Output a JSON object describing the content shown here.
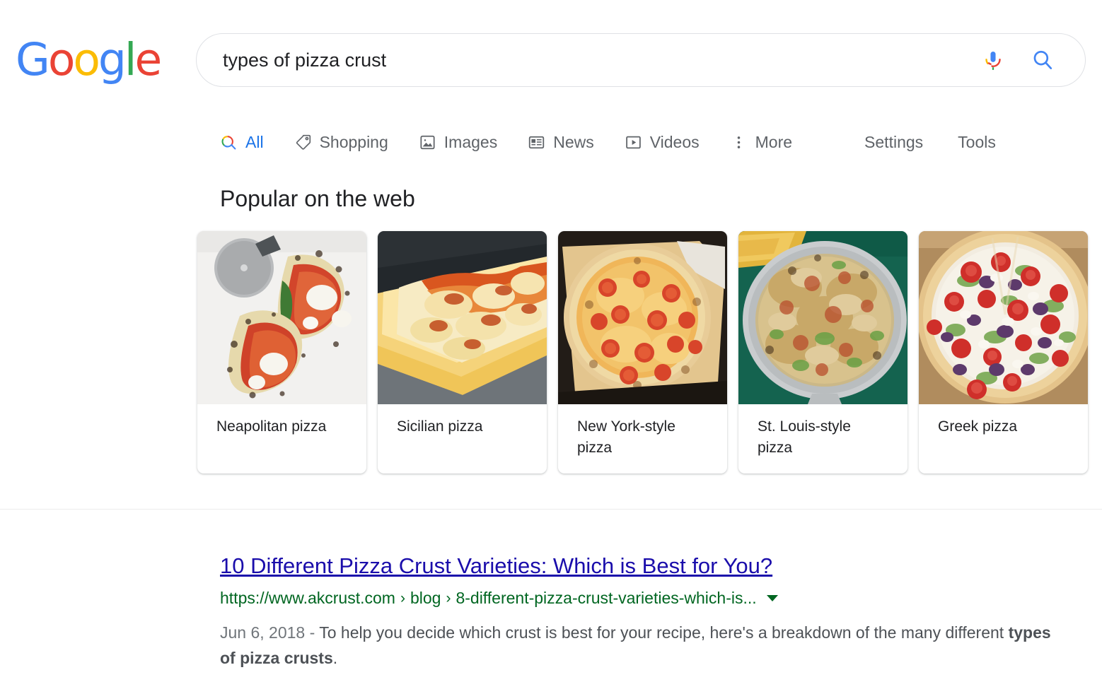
{
  "brand": {
    "logo_text": "Google",
    "logo_letters": [
      {
        "char": "G",
        "color": "#4285F4"
      },
      {
        "char": "o",
        "color": "#EA4335"
      },
      {
        "char": "o",
        "color": "#FBBC05"
      },
      {
        "char": "g",
        "color": "#4285F4"
      },
      {
        "char": "l",
        "color": "#34A853"
      },
      {
        "char": "e",
        "color": "#EA4335"
      }
    ]
  },
  "search": {
    "query": "types of pizza crust",
    "placeholder": "Search",
    "mic_icon": "microphone-icon",
    "search_icon": "search-icon"
  },
  "tabs": [
    {
      "label": "All",
      "icon": "search-icon",
      "active": true
    },
    {
      "label": "Shopping",
      "icon": "price-tag-icon",
      "active": false
    },
    {
      "label": "Images",
      "icon": "image-icon",
      "active": false
    },
    {
      "label": "News",
      "icon": "news-article-icon",
      "active": false
    },
    {
      "label": "Videos",
      "icon": "video-play-icon",
      "active": false
    },
    {
      "label": "More",
      "icon": "more-vertical-icon",
      "active": false
    }
  ],
  "tools": [
    {
      "label": "Settings"
    },
    {
      "label": "Tools"
    }
  ],
  "popular": {
    "heading": "Popular on the web",
    "cards": [
      {
        "label": "Neapolitan pizza",
        "image_alt": "neapolitan-pizza-photo"
      },
      {
        "label": "Sicilian pizza",
        "image_alt": "sicilian-pizza-photo"
      },
      {
        "label": "New York-style pizza",
        "image_alt": "new-york-style-pizza-photo"
      },
      {
        "label": "St. Louis-style pizza",
        "image_alt": "st-louis-style-pizza-photo"
      },
      {
        "label": "Greek pizza",
        "image_alt": "greek-pizza-photo"
      }
    ]
  },
  "result": {
    "title": "10 Different Pizza Crust Varieties: Which is Best for You?",
    "url_domain": "https://www.akcrust.com",
    "url_crumb1": "blog",
    "url_crumb2": "8-different-pizza-crust-varieties-which-is...",
    "url_separator": "›",
    "date": "Jun 6, 2018 - ",
    "snippet_part1": "To help you decide which crust is best for your recipe, here's a breakdown of the many different ",
    "snippet_bold": "types of pizza crusts",
    "snippet_part2": "."
  },
  "colors": {
    "link": "#1a0dab",
    "url_green": "#006621",
    "accent_blue": "#1a73e8",
    "text_gray": "#5f6368",
    "snippet_gray": "#4d5156"
  }
}
